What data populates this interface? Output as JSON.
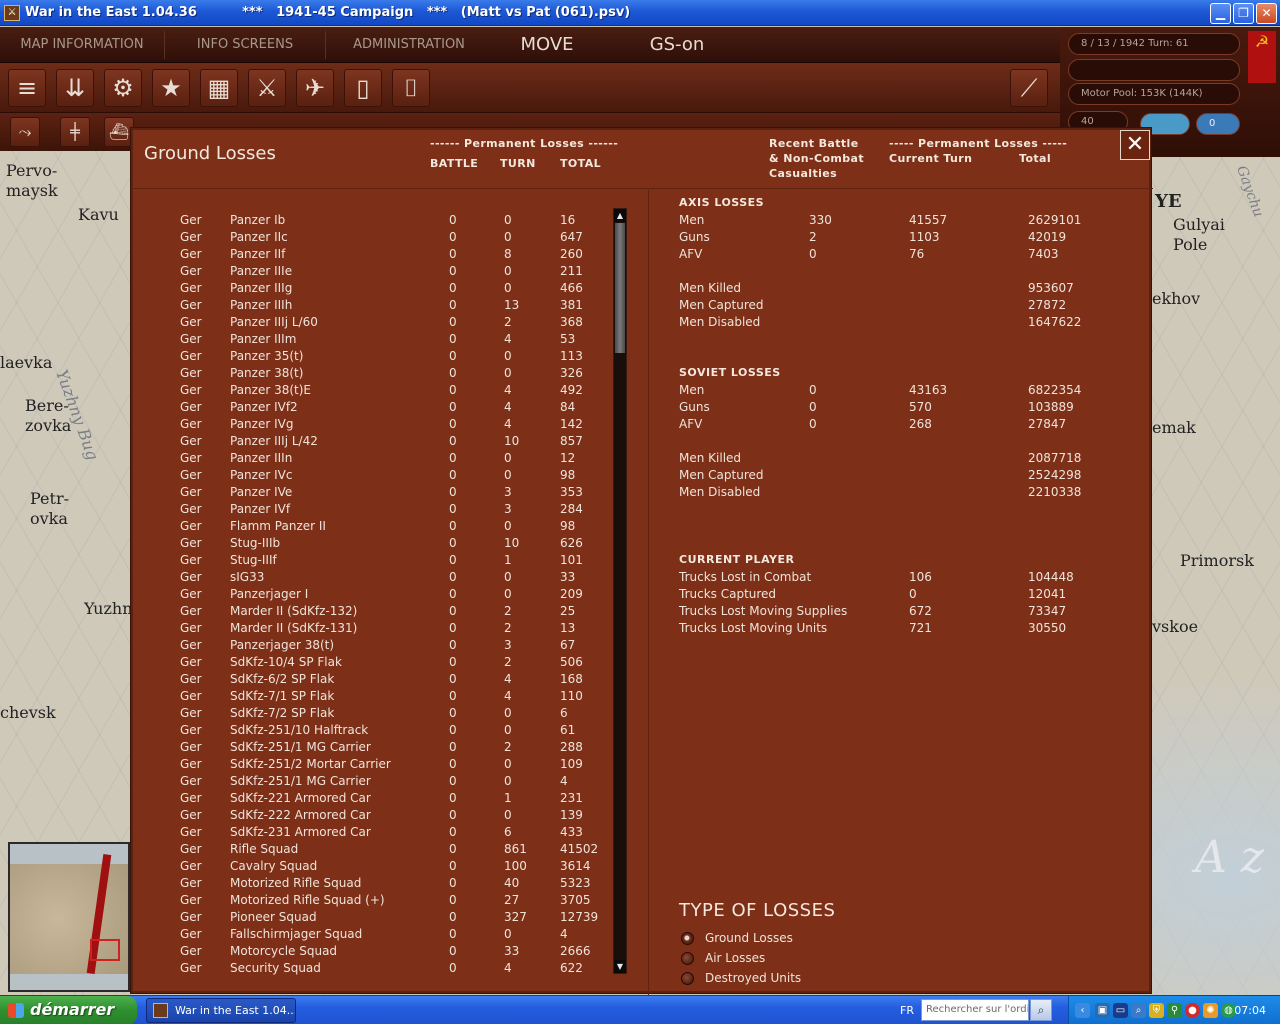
{
  "window": {
    "title": "War in the East 1.04.36          ***   1941-45 Campaign   ***   (Matt vs Pat (061).psv)",
    "btn_min": "▁",
    "btn_max": "❐",
    "btn_close": "✕"
  },
  "menu": {
    "map_info": "MAP INFORMATION",
    "info_screens": "INFO SCREENS",
    "administration": "ADMINISTRATION",
    "move": "MOVE",
    "gs": "GS-on"
  },
  "status": {
    "date_turn": "8 / 13 / 1942      Turn: 61",
    "motor_pool": "Motor Pool:  153K (144K)",
    "box_left": "40",
    "box_right": "0"
  },
  "map_labels": {
    "pervomaysk": "Pervo-\nmaysk",
    "kavun": "Kavu",
    "laevka": "laevka",
    "berezovka": "Bere-\nzovka",
    "petrovka": "Petr-\novka",
    "yuzhn": "Yuzhn",
    "chevsk": "chevsk",
    "river": "Yuzhny Bug",
    "ye": "YE",
    "gulyai": "Gulyai\nPole",
    "ekhov": "ekhov",
    "emak": "emak",
    "primorsk": "Primorsk",
    "vskoe": "vskoe",
    "sea": "A z",
    "gaychur": "Gaychu"
  },
  "dialog": {
    "title": "Ground Losses",
    "close": "✕",
    "left_header_group": "------ Permanent Losses ------",
    "col_battle": "BATTLE",
    "col_turn": "TURN",
    "col_total": "TOTAL",
    "right_header_recent": "Recent Battle\n& Non-Combat\nCasualties",
    "right_header_group": "----- Permanent Losses -----",
    "right_col_current": "Current Turn",
    "right_col_total": "Total"
  },
  "units": [
    [
      "Ger",
      "Panzer Ib",
      "0",
      "0",
      "16"
    ],
    [
      "Ger",
      "Panzer IIc",
      "0",
      "0",
      "647"
    ],
    [
      "Ger",
      "Panzer IIf",
      "0",
      "8",
      "260"
    ],
    [
      "Ger",
      "Panzer IIIe",
      "0",
      "0",
      "211"
    ],
    [
      "Ger",
      "Panzer IIIg",
      "0",
      "0",
      "466"
    ],
    [
      "Ger",
      "Panzer IIIh",
      "0",
      "13",
      "381"
    ],
    [
      "Ger",
      "Panzer IIIj L/60",
      "0",
      "2",
      "368"
    ],
    [
      "Ger",
      "Panzer IIIm",
      "0",
      "4",
      "53"
    ],
    [
      "Ger",
      "Panzer 35(t)",
      "0",
      "0",
      "113"
    ],
    [
      "Ger",
      "Panzer 38(t)",
      "0",
      "0",
      "326"
    ],
    [
      "Ger",
      "Panzer 38(t)E",
      "0",
      "4",
      "492"
    ],
    [
      "Ger",
      "Panzer IVf2",
      "0",
      "4",
      "84"
    ],
    [
      "Ger",
      "Panzer IVg",
      "0",
      "4",
      "142"
    ],
    [
      "Ger",
      "Panzer IIIj L/42",
      "0",
      "10",
      "857"
    ],
    [
      "Ger",
      "Panzer IIIn",
      "0",
      "0",
      "12"
    ],
    [
      "Ger",
      "Panzer IVc",
      "0",
      "0",
      "98"
    ],
    [
      "Ger",
      "Panzer IVe",
      "0",
      "3",
      "353"
    ],
    [
      "Ger",
      "Panzer IVf",
      "0",
      "3",
      "284"
    ],
    [
      "Ger",
      "Flamm Panzer II",
      "0",
      "0",
      "98"
    ],
    [
      "Ger",
      "Stug-IIIb",
      "0",
      "10",
      "626"
    ],
    [
      "Ger",
      "Stug-IIIf",
      "0",
      "1",
      "101"
    ],
    [
      "Ger",
      "sIG33",
      "0",
      "0",
      "33"
    ],
    [
      "Ger",
      "Panzerjager I",
      "0",
      "0",
      "209"
    ],
    [
      "Ger",
      "Marder II (SdKfz-132)",
      "0",
      "2",
      "25"
    ],
    [
      "Ger",
      "Marder II (SdKfz-131)",
      "0",
      "2",
      "13"
    ],
    [
      "Ger",
      "Panzerjager 38(t)",
      "0",
      "3",
      "67"
    ],
    [
      "Ger",
      "SdKfz-10/4 SP Flak",
      "0",
      "2",
      "506"
    ],
    [
      "Ger",
      "SdKfz-6/2 SP Flak",
      "0",
      "4",
      "168"
    ],
    [
      "Ger",
      "SdKfz-7/1 SP Flak",
      "0",
      "4",
      "110"
    ],
    [
      "Ger",
      "SdKfz-7/2 SP Flak",
      "0",
      "0",
      "6"
    ],
    [
      "Ger",
      "SdKfz-251/10 Halftrack",
      "0",
      "0",
      "61"
    ],
    [
      "Ger",
      "SdKfz-251/1 MG Carrier",
      "0",
      "2",
      "288"
    ],
    [
      "Ger",
      "SdKfz-251/2 Mortar Carrier",
      "0",
      "0",
      "109"
    ],
    [
      "Ger",
      "SdKfz-251/1 MG Carrier",
      "0",
      "0",
      "4"
    ],
    [
      "Ger",
      "SdKfz-221 Armored Car",
      "0",
      "1",
      "231"
    ],
    [
      "Ger",
      "SdKfz-222 Armored Car",
      "0",
      "0",
      "139"
    ],
    [
      "Ger",
      "SdKfz-231 Armored Car",
      "0",
      "6",
      "433"
    ],
    [
      "Ger",
      "Rifle Squad",
      "0",
      "861",
      "41502"
    ],
    [
      "Ger",
      "Cavalry Squad",
      "0",
      "100",
      "3614"
    ],
    [
      "Ger",
      "Motorized Rifle Squad",
      "0",
      "40",
      "5323"
    ],
    [
      "Ger",
      "Motorized Rifle Squad (+)",
      "0",
      "27",
      "3705"
    ],
    [
      "Ger",
      "Pioneer Squad",
      "0",
      "327",
      "12739"
    ],
    [
      "Ger",
      "Fallschirmjager Squad",
      "0",
      "0",
      "4"
    ],
    [
      "Ger",
      "Motorcycle Squad",
      "0",
      "33",
      "2666"
    ],
    [
      "Ger",
      "Security Squad",
      "0",
      "4",
      "622"
    ]
  ],
  "axis": {
    "header": "AXIS LOSSES",
    "rows": [
      [
        "Men",
        "330",
        "41557",
        "2629101"
      ],
      [
        "Guns",
        "2",
        "1103",
        "42019"
      ],
      [
        "AFV",
        "0",
        "76",
        "7403"
      ]
    ],
    "casualty_rows": [
      [
        "Men Killed",
        "",
        "",
        "953607"
      ],
      [
        "Men Captured",
        "",
        "",
        "27872"
      ],
      [
        "Men Disabled",
        "",
        "",
        "1647622"
      ]
    ]
  },
  "soviet": {
    "header": "SOVIET LOSSES",
    "rows": [
      [
        "Men",
        "0",
        "43163",
        "6822354"
      ],
      [
        "Guns",
        "0",
        "570",
        "103889"
      ],
      [
        "AFV",
        "0",
        "268",
        "27847"
      ]
    ],
    "casualty_rows": [
      [
        "Men Killed",
        "",
        "",
        "2087718"
      ],
      [
        "Men Captured",
        "",
        "",
        "2524298"
      ],
      [
        "Men Disabled",
        "",
        "",
        "2210338"
      ]
    ]
  },
  "player": {
    "header": "CURRENT PLAYER",
    "rows": [
      [
        "Trucks Lost in Combat",
        "",
        "106",
        "104448"
      ],
      [
        "Trucks Captured",
        "",
        "0",
        "12041"
      ],
      [
        "Trucks Lost Moving Supplies",
        "",
        "672",
        "73347"
      ],
      [
        "Trucks Lost Moving Units",
        "",
        "721",
        "30550"
      ]
    ]
  },
  "loss_types": {
    "header": "TYPE OF LOSSES",
    "options": [
      "Ground Losses",
      "Air Losses",
      "Destroyed Units"
    ],
    "selected": 0
  },
  "taskbar": {
    "start": "démarrer",
    "task": "War in the East 1.04....",
    "lang": "FR",
    "search_placeholder": "Rechercher sur l'ordinateur",
    "clock": "07:04"
  },
  "colors": {
    "dialog_bg": "#7d2f18",
    "menubar": "#2e0f08",
    "xp_blue": "#245ee0",
    "start_green": "#2f8f2f"
  }
}
